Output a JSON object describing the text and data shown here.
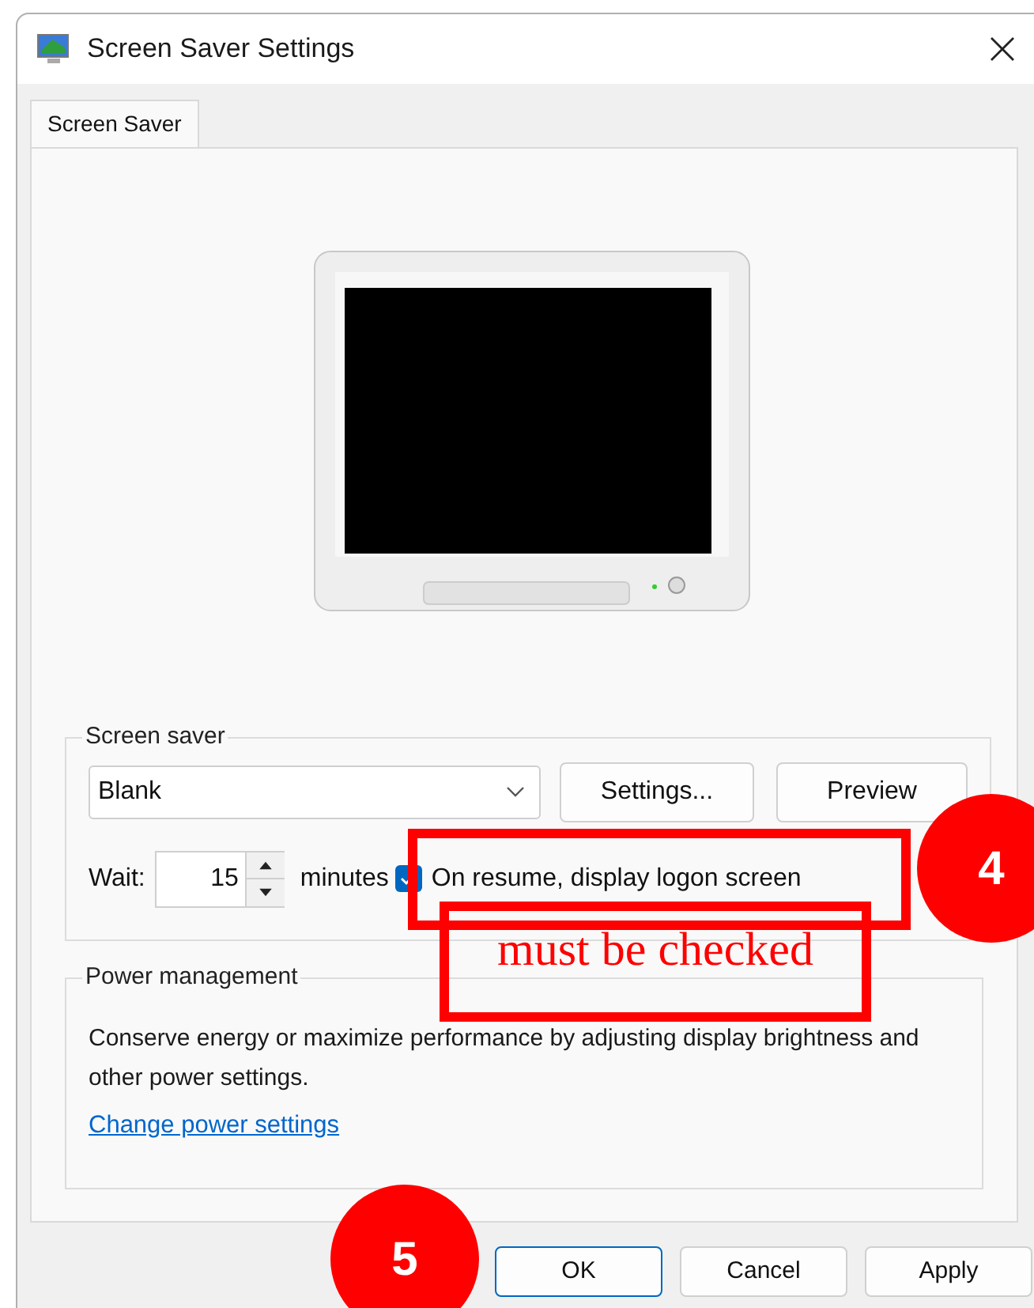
{
  "window": {
    "title": "Screen Saver Settings"
  },
  "tabs": [
    {
      "label": "Screen Saver",
      "selected": true
    }
  ],
  "screen_saver": {
    "heading": "Screen saver",
    "selected_saver": "Blank",
    "buttons": [
      "Settings...",
      "Preview"
    ],
    "wait_label": "Wait:",
    "wait_value": "15",
    "wait_unit": "minutes",
    "logon": {
      "label": "On resume, display logon screen",
      "checked": true
    }
  },
  "power": {
    "heading": "Power management",
    "description": "Conserve energy or maximize performance by adjusting display brightness and other power settings.",
    "link": "Change power settings"
  },
  "buttons": [
    {
      "label": "OK",
      "default": true
    },
    {
      "label": "Cancel",
      "default": false
    },
    {
      "label": "Apply",
      "default": false
    }
  ],
  "annotations": [
    {
      "kind": "step",
      "label": "4"
    },
    {
      "kind": "note",
      "label": "must be checked"
    },
    {
      "kind": "step",
      "label": "5"
    }
  ]
}
